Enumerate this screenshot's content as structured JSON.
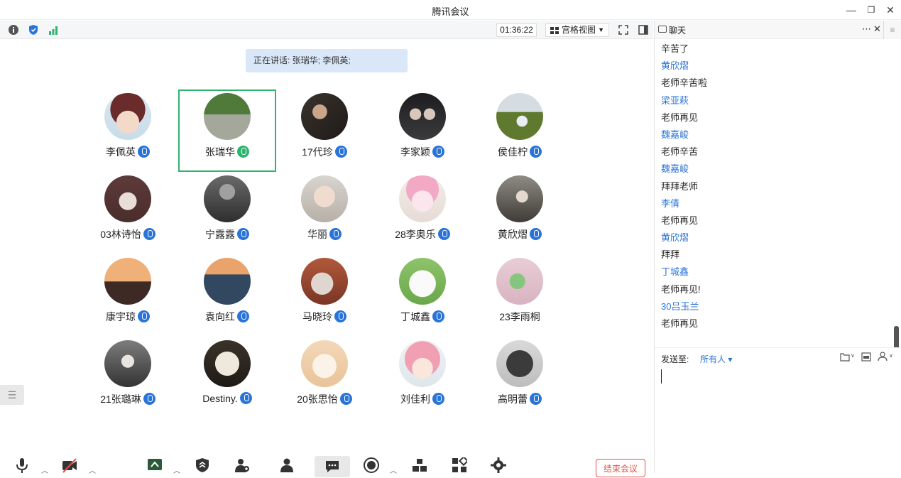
{
  "window": {
    "title": "腾讯会议",
    "minimize": "—",
    "restore": "❐",
    "close": "✕"
  },
  "toolbar": {
    "timer": "01:36:22",
    "view_label": "宫格视图",
    "view_caret": "▼"
  },
  "speaking": {
    "text": "正在讲话: 张瑞华; 李佩英;"
  },
  "participants": [
    {
      "name": "李佩英",
      "active": false,
      "mic_color": "#2a74d8",
      "avatar": "cartoon-girl"
    },
    {
      "name": "张瑞华",
      "active": true,
      "mic_color": "#2fb46e",
      "avatar": "park-photo"
    },
    {
      "name": "17代珍",
      "active": false,
      "mic_color": "#2a74d8",
      "avatar": "person-dark"
    },
    {
      "name": "李家颖",
      "active": false,
      "mic_color": "#2a74d8",
      "avatar": "two-people-dark"
    },
    {
      "name": "侯佳柠",
      "active": false,
      "mic_color": "#2a74d8",
      "avatar": "field-person"
    },
    {
      "name": "03林诗怡",
      "active": false,
      "mic_color": "#2a74d8",
      "avatar": "keychain"
    },
    {
      "name": "宁露露",
      "active": false,
      "mic_color": "#2a74d8",
      "avatar": "girl-grey"
    },
    {
      "name": "华丽",
      "active": false,
      "mic_color": "#2a74d8",
      "avatar": "girl-light"
    },
    {
      "name": "28李奥乐",
      "active": false,
      "mic_color": "#2a74d8",
      "avatar": "pink-bunny"
    },
    {
      "name": "黄欣熠",
      "active": false,
      "mic_color": "#2a74d8",
      "avatar": "person-outdoor"
    },
    {
      "name": "康宇琼",
      "active": false,
      "mic_color": "#2a74d8",
      "avatar": "sunset-silhouette"
    },
    {
      "name": "袁向红",
      "active": false,
      "mic_color": "#2a74d8",
      "avatar": "sunset-hand"
    },
    {
      "name": "马晓玲",
      "active": false,
      "mic_color": "#2a74d8",
      "avatar": "cat-lying"
    },
    {
      "name": "丁城鑫",
      "active": false,
      "mic_color": "#2a74d8",
      "avatar": "white-cat"
    },
    {
      "name": "23李雨桐",
      "active": false,
      "mic_color": "#2a74d8",
      "avatar": "pink-frog",
      "no_mic": true
    },
    {
      "name": "21张璐琳",
      "active": false,
      "mic_color": "#2a74d8",
      "avatar": "girl-street"
    },
    {
      "name": "Destiny.",
      "active": false,
      "mic_color": "#2a74d8",
      "avatar": "dog"
    },
    {
      "name": "20张思怡",
      "active": false,
      "mic_color": "#2a74d8",
      "avatar": "cartoon-paper"
    },
    {
      "name": "刘佳利",
      "active": false,
      "mic_color": "#2a74d8",
      "avatar": "anime-girl"
    },
    {
      "name": "高明蕾",
      "active": false,
      "mic_color": "#2a74d8",
      "avatar": "girl-dark-hair"
    }
  ],
  "chat": {
    "title": "聊天",
    "menu": "⋯",
    "close": "✕",
    "messages": [
      {
        "type": "text",
        "value": "辛苦了"
      },
      {
        "type": "sender",
        "value": "黄欣熠"
      },
      {
        "type": "text",
        "value": "老师辛苦啦"
      },
      {
        "type": "sender",
        "value": "梁亚萩"
      },
      {
        "type": "text",
        "value": "老师再见"
      },
      {
        "type": "sender",
        "value": "魏嘉峻"
      },
      {
        "type": "text",
        "value": "老师辛苦"
      },
      {
        "type": "sender",
        "value": "魏嘉峻"
      },
      {
        "type": "text",
        "value": "拜拜老师"
      },
      {
        "type": "sender",
        "value": "李倩"
      },
      {
        "type": "text",
        "value": "老师再见"
      },
      {
        "type": "sender",
        "value": "黄欣熠"
      },
      {
        "type": "text",
        "value": "拜拜"
      },
      {
        "type": "sender",
        "value": "丁城鑫"
      },
      {
        "type": "text",
        "value": "老师再见!"
      },
      {
        "type": "sender",
        "value": "30吕玉兰"
      },
      {
        "type": "text",
        "value": "老师再见"
      }
    ],
    "send_to_label": "发送至:",
    "recipient": "所有人 ▾"
  },
  "bottom": {
    "end_meeting": "结束会议"
  },
  "colors": {
    "accent": "#2a74d8",
    "active": "#2fb46e",
    "danger": "#e0514b"
  }
}
